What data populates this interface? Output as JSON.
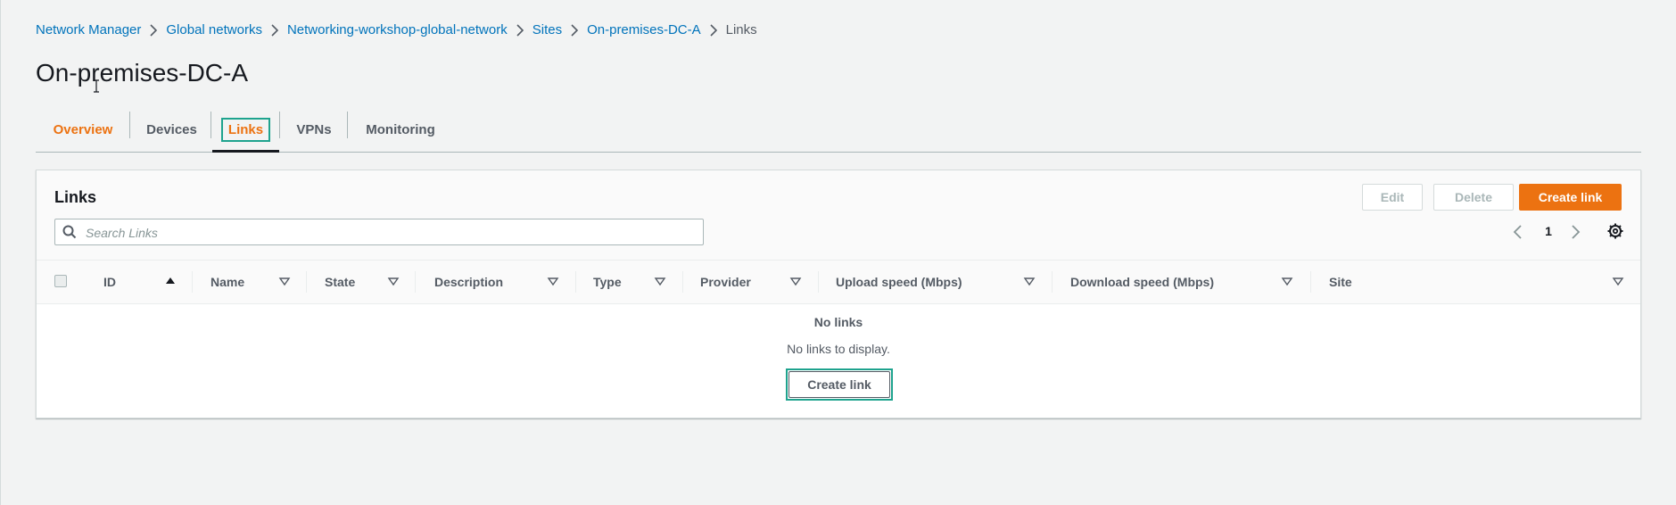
{
  "breadcrumb": {
    "items": [
      "Network Manager",
      "Global networks",
      "Networking-workshop-global-network",
      "Sites",
      "On-premises-DC-A"
    ],
    "current": "Links"
  },
  "page": {
    "title": "On-premises-DC-A"
  },
  "tabs": {
    "overview": "Overview",
    "devices": "Devices",
    "links": "Links",
    "vpns": "VPNs",
    "monitoring": "Monitoring"
  },
  "panel": {
    "title": "Links",
    "buttons": {
      "edit": "Edit",
      "delete": "Delete",
      "create": "Create link"
    },
    "search": {
      "placeholder": "Search Links",
      "value": ""
    },
    "pagination": {
      "current_page": "1"
    }
  },
  "table": {
    "columns": [
      "ID",
      "Name",
      "State",
      "Description",
      "Type",
      "Provider",
      "Upload speed (Mbps)",
      "Download speed (Mbps)",
      "Site"
    ],
    "rows": [],
    "empty": {
      "title": "No links",
      "description": "No links to display.",
      "button": "Create link"
    }
  },
  "colors": {
    "accent_orange": "#ec7211",
    "link_blue": "#0073bb",
    "focus_teal": "#1ea38e",
    "background": "#f2f3f3"
  }
}
